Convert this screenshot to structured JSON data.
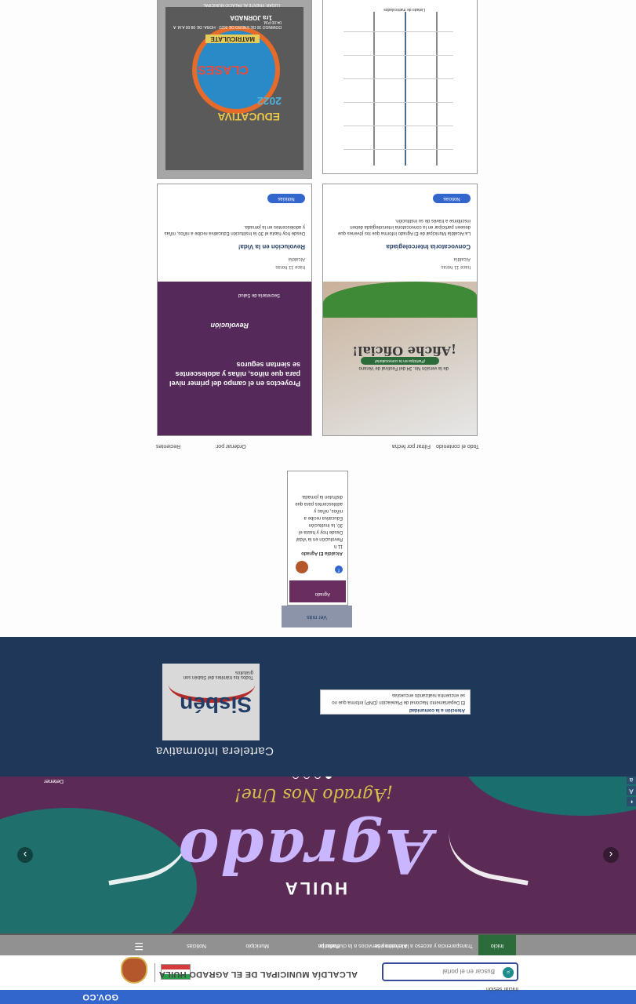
{
  "gov": {
    "logo": "GOV.CO"
  },
  "header": {
    "site_title": "ALCALDÍA MUNICIPAL DE EL AGRADO HUILA",
    "search_placeholder": "Buscar en el portal",
    "search_icon": "search-icon",
    "top_link": "Iniciar sesión"
  },
  "nav": {
    "items": [
      {
        "label": "Inicio"
      },
      {
        "label": "Transparencia y acceso a la información"
      },
      {
        "label": "Atención y servicios a la ciudadanía"
      },
      {
        "label": "Participa"
      },
      {
        "label": "Municipio"
      },
      {
        "label": "Noticias"
      }
    ],
    "menu_icon": "hamburger-icon"
  },
  "slider": {
    "brand": "Agrado",
    "region": "HUILA",
    "tagline": "¡Agrado Nos Une!",
    "prev": "‹",
    "next": "›",
    "pause": "Detener",
    "active_slide": 1,
    "slide_count": 4
  },
  "cartelera": {
    "heading": "Cartelera Informativa",
    "sisben_word": "Sisbén",
    "sisben_sub": "Todos los trámites del Sisbén son gratuitos",
    "notice_title": "Atención a la comunidad",
    "notice_line1": "El Departamento Nacional de Planeación (DNP) informa que no",
    "notice_line2": "se encuentra realizando encuestas"
  },
  "widget": {
    "button": "Ver más",
    "thumb_text": "Agrado",
    "author": "Alcaldía El Agrado",
    "date": "11 h",
    "text": "Revolución en la Vida! Desde hoy y hasta el 30, la Institución Educativa recibe a niños, niñas y adolescentes para que disfruten la jornada."
  },
  "filters": {
    "order_label": "Ordenar por:",
    "order_value": "Recientes",
    "filter_label": "Filtrar por fecha",
    "all_label": "Todo el contenido"
  },
  "posts": [
    {
      "date": "hace 11 horas",
      "author": "Alcaldía",
      "title": "Convocatoria Intercolegiada",
      "excerpt": "La Alcaldía Municipal de El Agrado informa que los jóvenes que deseen participar en la convocatoria intercolegiada deben inscribirse a través de su institución.",
      "chip": "Noticias",
      "banner_title": "¡Afiche Oficial!",
      "banner_sub": "de la versión No. 34 del Festival de Verano",
      "banner_pill": "¡Participa en la convocatoria!"
    },
    {
      "date": "hace 11 horas",
      "author": "Alcaldía",
      "title": "Revolución en la Vida!",
      "excerpt": "Desde hoy hasta el 30 la Institución Educativa recibe a niños, niñas y adolescentes en la jornada.",
      "chip": "Noticias",
      "headline": "Proyectos en el campo del primer nivel para que niños, niñas y adolescentes se sientan seguros",
      "pill": "Revolución",
      "foot": "Secretaría de Salud"
    },
    {
      "caption": "Listado de matriculados"
    },
    {
      "t1": "EDUCATIVA",
      "t2": "2022",
      "t3": "CLASES",
      "label": "MATRICÚLATE",
      "sched": "DOMINGO 30 DE ENERO DE 2022 · HORA: DE 08:00 A.M. A 04:00 P.M.",
      "t4": "1ra JORNADA",
      "t5": "LUGAR: FRENTE AL PALACIO MUNICIPAL"
    }
  ],
  "colors": {
    "gov_blue": "#3366cc",
    "navy": "#1f3758",
    "nav_gray": "#919191",
    "nav_active": "#2c6b3a",
    "slider_purple": "#5b2a55"
  }
}
